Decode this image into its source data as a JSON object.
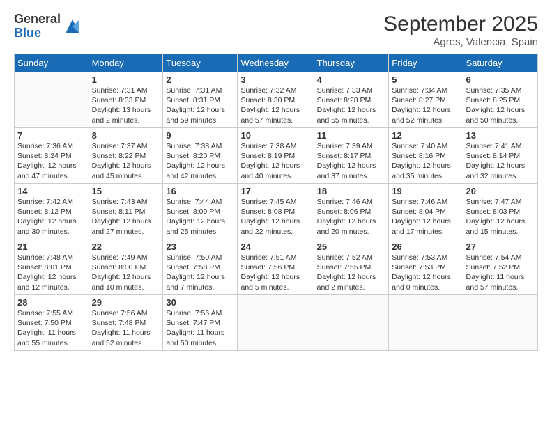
{
  "logo": {
    "general": "General",
    "blue": "Blue"
  },
  "title": "September 2025",
  "subtitle": "Agres, Valencia, Spain",
  "days_header": [
    "Sunday",
    "Monday",
    "Tuesday",
    "Wednesday",
    "Thursday",
    "Friday",
    "Saturday"
  ],
  "weeks": [
    [
      {
        "day": "",
        "info": ""
      },
      {
        "day": "1",
        "info": "Sunrise: 7:31 AM\nSunset: 8:33 PM\nDaylight: 13 hours\nand 2 minutes."
      },
      {
        "day": "2",
        "info": "Sunrise: 7:31 AM\nSunset: 8:31 PM\nDaylight: 12 hours\nand 59 minutes."
      },
      {
        "day": "3",
        "info": "Sunrise: 7:32 AM\nSunset: 8:30 PM\nDaylight: 12 hours\nand 57 minutes."
      },
      {
        "day": "4",
        "info": "Sunrise: 7:33 AM\nSunset: 8:28 PM\nDaylight: 12 hours\nand 55 minutes."
      },
      {
        "day": "5",
        "info": "Sunrise: 7:34 AM\nSunset: 8:27 PM\nDaylight: 12 hours\nand 52 minutes."
      },
      {
        "day": "6",
        "info": "Sunrise: 7:35 AM\nSunset: 8:25 PM\nDaylight: 12 hours\nand 50 minutes."
      }
    ],
    [
      {
        "day": "7",
        "info": "Sunrise: 7:36 AM\nSunset: 8:24 PM\nDaylight: 12 hours\nand 47 minutes."
      },
      {
        "day": "8",
        "info": "Sunrise: 7:37 AM\nSunset: 8:22 PM\nDaylight: 12 hours\nand 45 minutes."
      },
      {
        "day": "9",
        "info": "Sunrise: 7:38 AM\nSunset: 8:20 PM\nDaylight: 12 hours\nand 42 minutes."
      },
      {
        "day": "10",
        "info": "Sunrise: 7:38 AM\nSunset: 8:19 PM\nDaylight: 12 hours\nand 40 minutes."
      },
      {
        "day": "11",
        "info": "Sunrise: 7:39 AM\nSunset: 8:17 PM\nDaylight: 12 hours\nand 37 minutes."
      },
      {
        "day": "12",
        "info": "Sunrise: 7:40 AM\nSunset: 8:16 PM\nDaylight: 12 hours\nand 35 minutes."
      },
      {
        "day": "13",
        "info": "Sunrise: 7:41 AM\nSunset: 8:14 PM\nDaylight: 12 hours\nand 32 minutes."
      }
    ],
    [
      {
        "day": "14",
        "info": "Sunrise: 7:42 AM\nSunset: 8:12 PM\nDaylight: 12 hours\nand 30 minutes."
      },
      {
        "day": "15",
        "info": "Sunrise: 7:43 AM\nSunset: 8:11 PM\nDaylight: 12 hours\nand 27 minutes."
      },
      {
        "day": "16",
        "info": "Sunrise: 7:44 AM\nSunset: 8:09 PM\nDaylight: 12 hours\nand 25 minutes."
      },
      {
        "day": "17",
        "info": "Sunrise: 7:45 AM\nSunset: 8:08 PM\nDaylight: 12 hours\nand 22 minutes."
      },
      {
        "day": "18",
        "info": "Sunrise: 7:46 AM\nSunset: 8:06 PM\nDaylight: 12 hours\nand 20 minutes."
      },
      {
        "day": "19",
        "info": "Sunrise: 7:46 AM\nSunset: 8:04 PM\nDaylight: 12 hours\nand 17 minutes."
      },
      {
        "day": "20",
        "info": "Sunrise: 7:47 AM\nSunset: 8:03 PM\nDaylight: 12 hours\nand 15 minutes."
      }
    ],
    [
      {
        "day": "21",
        "info": "Sunrise: 7:48 AM\nSunset: 8:01 PM\nDaylight: 12 hours\nand 12 minutes."
      },
      {
        "day": "22",
        "info": "Sunrise: 7:49 AM\nSunset: 8:00 PM\nDaylight: 12 hours\nand 10 minutes."
      },
      {
        "day": "23",
        "info": "Sunrise: 7:50 AM\nSunset: 7:58 PM\nDaylight: 12 hours\nand 7 minutes."
      },
      {
        "day": "24",
        "info": "Sunrise: 7:51 AM\nSunset: 7:56 PM\nDaylight: 12 hours\nand 5 minutes."
      },
      {
        "day": "25",
        "info": "Sunrise: 7:52 AM\nSunset: 7:55 PM\nDaylight: 12 hours\nand 2 minutes."
      },
      {
        "day": "26",
        "info": "Sunrise: 7:53 AM\nSunset: 7:53 PM\nDaylight: 12 hours\nand 0 minutes."
      },
      {
        "day": "27",
        "info": "Sunrise: 7:54 AM\nSunset: 7:52 PM\nDaylight: 11 hours\nand 57 minutes."
      }
    ],
    [
      {
        "day": "28",
        "info": "Sunrise: 7:55 AM\nSunset: 7:50 PM\nDaylight: 11 hours\nand 55 minutes."
      },
      {
        "day": "29",
        "info": "Sunrise: 7:56 AM\nSunset: 7:48 PM\nDaylight: 11 hours\nand 52 minutes."
      },
      {
        "day": "30",
        "info": "Sunrise: 7:56 AM\nSunset: 7:47 PM\nDaylight: 11 hours\nand 50 minutes."
      },
      {
        "day": "",
        "info": ""
      },
      {
        "day": "",
        "info": ""
      },
      {
        "day": "",
        "info": ""
      },
      {
        "day": "",
        "info": ""
      }
    ]
  ]
}
